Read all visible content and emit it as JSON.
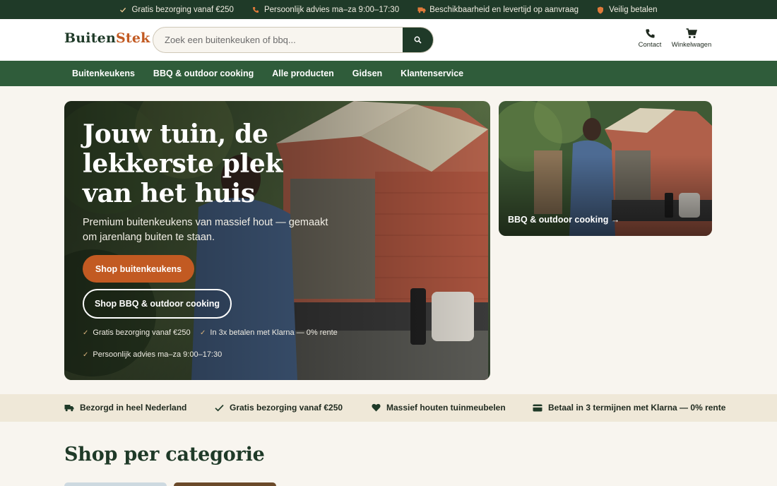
{
  "topbar": {
    "items": [
      {
        "icon": "check-icon",
        "label": "Gratis bezorging vanaf €250"
      },
      {
        "icon": "phone-icon",
        "label": "Persoonlijk advies ma–za 9:00–17:30"
      },
      {
        "icon": "truck-icon",
        "label": "Beschikbaarheid en levertijd op aanvraag"
      },
      {
        "icon": "shield-icon",
        "label": "Veilig betalen"
      }
    ]
  },
  "header": {
    "logo_a": "Buiten",
    "logo_b": "Stek",
    "search_placeholder": "Zoek een buitenkeuken of bbq...",
    "contact_label": "Contact",
    "cart_label": "Winkelwagen"
  },
  "nav": {
    "items": [
      "Buitenkeukens",
      "BBQ & outdoor cooking",
      "Alle producten",
      "Gidsen",
      "Klantenservice"
    ]
  },
  "hero": {
    "title": "Jouw tuin, de lekkerste plek van het huis",
    "subtitle": "Premium buitenkeukens van massief hout — gemaakt om jarenlang buiten te staan.",
    "primary_cta": "Shop buitenkeukens",
    "secondary_cta": "Shop BBQ & outdoor cooking",
    "checks": [
      "Gratis bezorging vanaf €250",
      "In 3x betalen met Klarna — 0% rente",
      "Persoonlijk advies ma–za 9:00–17:30"
    ]
  },
  "promo": {
    "label": "BBQ & outdoor cooking →"
  },
  "usps": {
    "items": [
      {
        "icon": "truck-icon",
        "label": "Bezorgd in heel Nederland"
      },
      {
        "icon": "check-icon",
        "label": "Gratis bezorging vanaf €250"
      },
      {
        "icon": "heart-icon",
        "label": "Massief houten tuinmeubelen"
      },
      {
        "icon": "card-icon",
        "label": "Betaal in 3 termijnen met Klarna — 0% rente"
      }
    ]
  },
  "section": {
    "title": "Shop per categorie"
  },
  "colors": {
    "brand_dark_green": "#1f3a28",
    "nav_green": "#2f5c3a",
    "accent_orange": "#c25a22",
    "background": "#f8f5ef",
    "usp_background": "#efe8d8"
  }
}
